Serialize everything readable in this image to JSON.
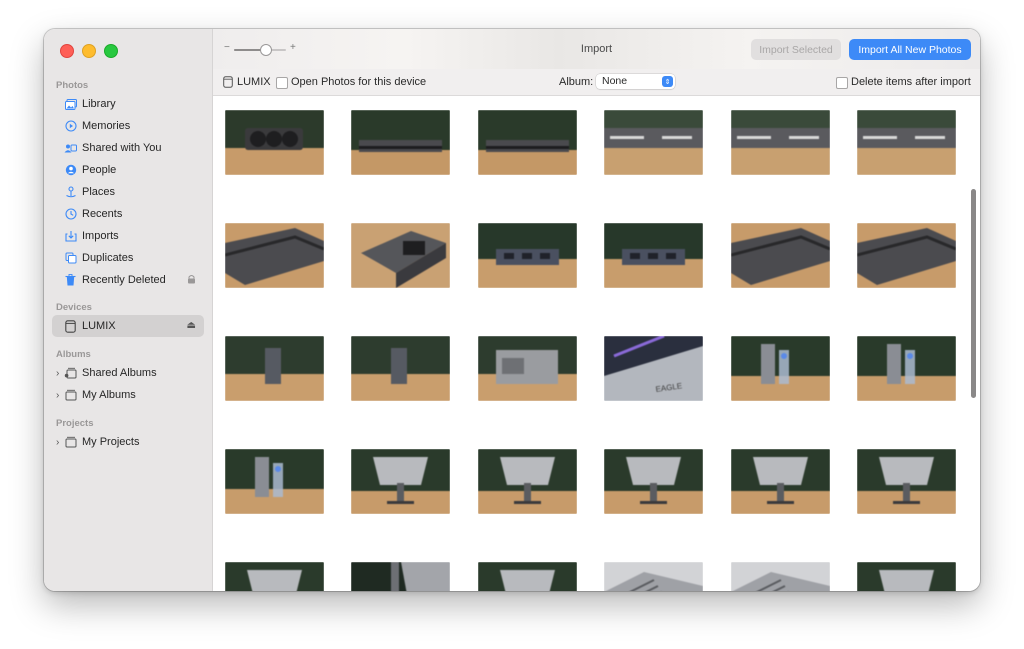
{
  "window": {
    "title": "Import"
  },
  "toolbar": {
    "zoom_minus": "−",
    "zoom_plus": "+",
    "zoom_level": 0.5,
    "import_selected_label": "Import Selected",
    "import_all_label": "Import All New Photos"
  },
  "options_bar": {
    "device_name": "LUMIX",
    "open_photos_label": "Open Photos for this device",
    "open_photos_checked": false,
    "album_label": "Album:",
    "album_value": "None",
    "delete_after_label": "Delete items after import",
    "delete_after_checked": false
  },
  "sidebar": {
    "sections": {
      "photos": "Photos",
      "devices": "Devices",
      "albums": "Albums",
      "projects": "Projects"
    },
    "photos_items": [
      {
        "label": "Library",
        "icon": "library-icon"
      },
      {
        "label": "Memories",
        "icon": "memories-icon"
      },
      {
        "label": "Shared with You",
        "icon": "shared-with-you-icon"
      },
      {
        "label": "People",
        "icon": "people-icon"
      },
      {
        "label": "Places",
        "icon": "places-icon"
      },
      {
        "label": "Recents",
        "icon": "recents-icon"
      },
      {
        "label": "Imports",
        "icon": "imports-icon"
      },
      {
        "label": "Duplicates",
        "icon": "duplicates-icon"
      },
      {
        "label": "Recently Deleted",
        "icon": "trash-icon"
      }
    ],
    "devices_items": [
      {
        "label": "LUMIX",
        "icon": "camera-device-icon",
        "selected": true
      }
    ],
    "albums_items": [
      {
        "label": "Shared Albums",
        "icon": "shared-albums-icon"
      },
      {
        "label": "My Albums",
        "icon": "albums-icon"
      }
    ],
    "projects_items": [
      {
        "label": "My Projects",
        "icon": "projects-icon"
      }
    ]
  },
  "colors": {
    "accent": "#3d8af7",
    "sidebar_bg": "#e8e6e6",
    "close": "#fe5f57",
    "minimize": "#febc2e",
    "zoom": "#28c840"
  },
  "photos": [
    {
      "scene": "gpu-fans"
    },
    {
      "scene": "gpu-side-bar"
    },
    {
      "scene": "gpu-side-bar"
    },
    {
      "scene": "gpu-side-label"
    },
    {
      "scene": "gpu-side-label"
    },
    {
      "scene": "gpu-side-label"
    },
    {
      "scene": "gpu-angle"
    },
    {
      "scene": "gpu-end"
    },
    {
      "scene": "gpu-bracket"
    },
    {
      "scene": "gpu-bracket"
    },
    {
      "scene": "gpu-angle"
    },
    {
      "scene": "gpu-angle"
    },
    {
      "scene": "gpu-upright"
    },
    {
      "scene": "gpu-upright"
    },
    {
      "scene": "gpu-backplate"
    },
    {
      "scene": "gpu-eagle-closeup"
    },
    {
      "scene": "gpu-bottle"
    },
    {
      "scene": "gpu-bottle"
    },
    {
      "scene": "gpu-bottle"
    },
    {
      "scene": "monitor-back"
    },
    {
      "scene": "monitor-back"
    },
    {
      "scene": "monitor-back"
    },
    {
      "scene": "monitor-back"
    },
    {
      "scene": "monitor-back"
    },
    {
      "scene": "monitor-back"
    },
    {
      "scene": "monitor-side"
    },
    {
      "scene": "monitor-back"
    },
    {
      "scene": "monitor-closeup"
    },
    {
      "scene": "monitor-closeup"
    },
    {
      "scene": "monitor-back"
    }
  ]
}
